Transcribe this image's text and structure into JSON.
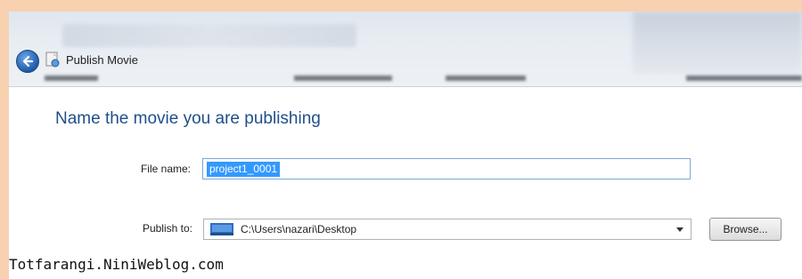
{
  "window": {
    "title": "Publish Movie"
  },
  "dialog": {
    "heading": "Name the movie you are publishing",
    "file_name_label": "File name:",
    "file_name_value": "project1_0001",
    "publish_to_label": "Publish to:",
    "publish_to_value": "C:\\Users\\nazari\\Desktop",
    "browse_label": "Browse..."
  },
  "watermark": "Totfarangi.NiniWeblog.com",
  "icons": {
    "back": "back-arrow-icon",
    "title": "publish-movie-icon",
    "folder": "desktop-folder-icon",
    "dropdown": "chevron-down-icon"
  },
  "colors": {
    "background": "#f7d1b0",
    "heading": "#1f4f8a",
    "selection": "#3399ff"
  }
}
